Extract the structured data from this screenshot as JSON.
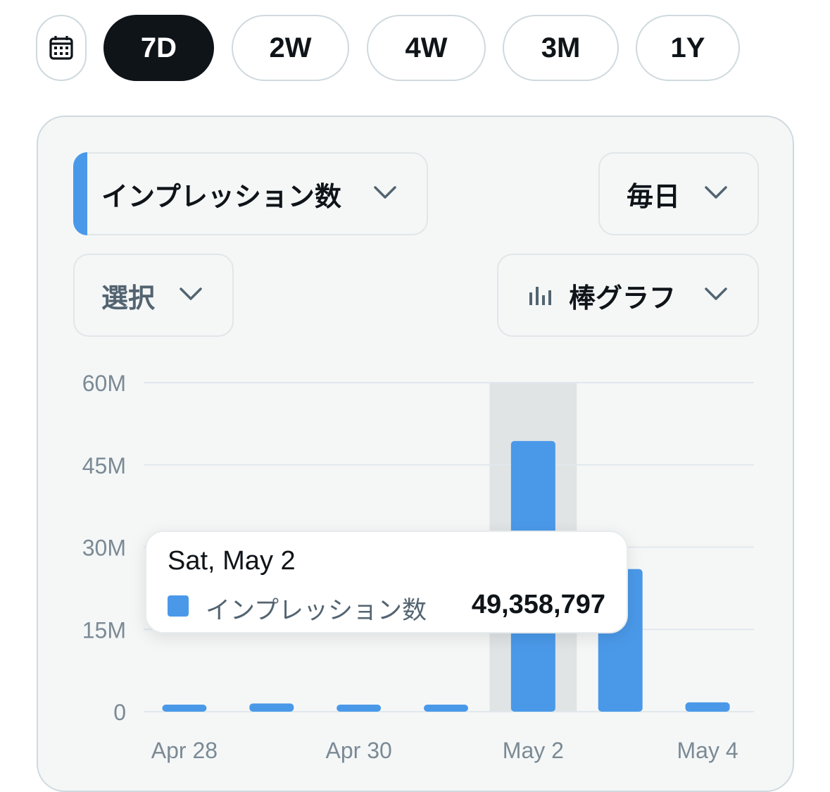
{
  "range_tabs": {
    "calendar_icon": "calendar-icon",
    "options": [
      "7D",
      "2W",
      "4W",
      "3M",
      "1Y"
    ],
    "selected": "7D"
  },
  "controls": {
    "metric": {
      "label": "インプレッション数",
      "accent_color": "#4a99e9"
    },
    "interval": {
      "label": "毎日"
    },
    "compare": {
      "label": "選択"
    },
    "chart_type": {
      "label": "棒グラフ",
      "icon": "bar-chart-icon"
    }
  },
  "tooltip": {
    "date": "Sat, May 2",
    "series_label": "インプレッション数",
    "value": "49,358,797"
  },
  "colors": {
    "bar": "#4a99e9",
    "highlight": "#e1e4e5",
    "grid": "#e1e8ed",
    "axis_text": "#7b8a95"
  },
  "chart_data": {
    "type": "bar",
    "categories": [
      "Apr 28",
      "Apr 29",
      "Apr 30",
      "May 1",
      "May 2",
      "May 3",
      "May 4"
    ],
    "x_tick_labels": [
      "Apr 28",
      "Apr 30",
      "May 2",
      "May 4"
    ],
    "series": [
      {
        "name": "インプレッション数",
        "values": [
          700000,
          1500000,
          800000,
          1000000,
          49358797,
          26000000,
          1700000
        ]
      }
    ],
    "y_ticks": [
      0,
      15000000,
      30000000,
      45000000,
      60000000
    ],
    "y_tick_labels": [
      "0",
      "15M",
      "30M",
      "45M",
      "60M"
    ],
    "ylim": [
      0,
      60000000
    ],
    "highlighted_category": "May 2",
    "grid": true
  }
}
